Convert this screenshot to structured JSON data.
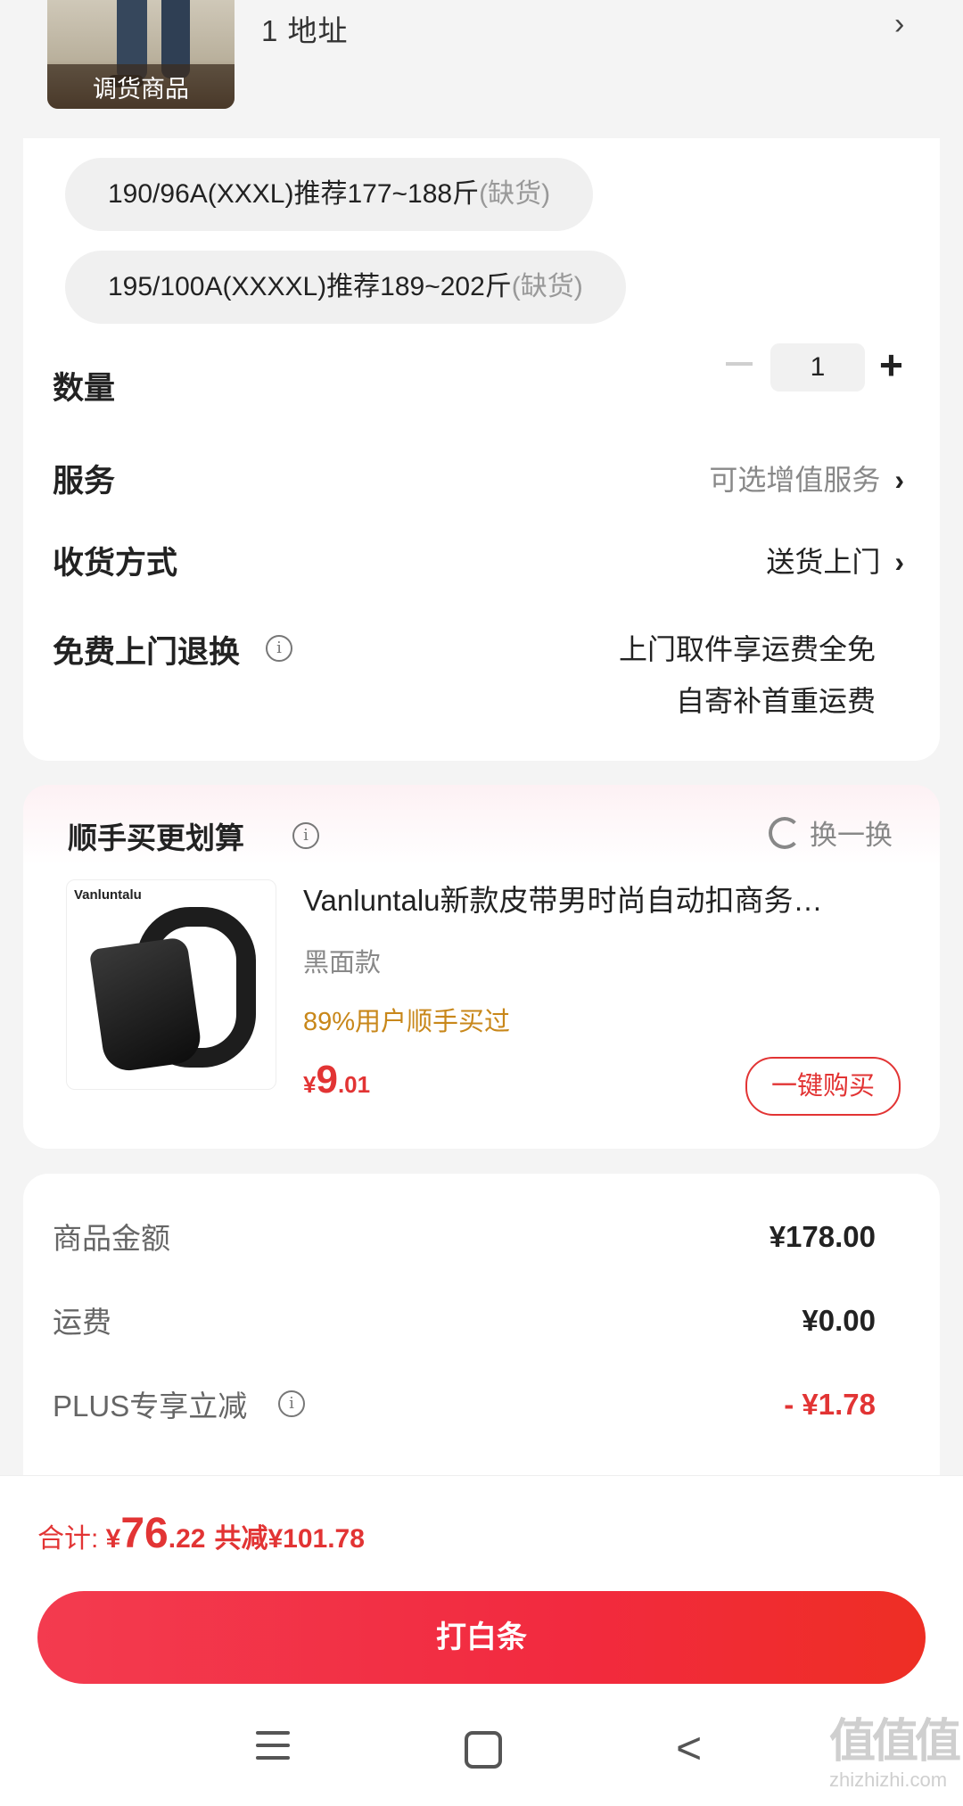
{
  "product": {
    "thumb_label": "调货商品",
    "address_line": "1  地址",
    "address_arrow": "›"
  },
  "options": {
    "sizes": [
      {
        "label": "190/96A(XXXL)推荐177~188斤",
        "status": "(缺货)"
      },
      {
        "label": "195/100A(XXXXL)推荐189~202斤",
        "status": "(缺货)"
      }
    ],
    "quantity": {
      "label": "数量",
      "minus": "−",
      "value": "1",
      "plus": "+"
    },
    "service": {
      "label": "服务",
      "value": "可选增值服务",
      "arrow": "›"
    },
    "delivery": {
      "label": "收货方式",
      "value": "送货上门",
      "arrow": "›"
    },
    "return": {
      "label": "免费上门退换",
      "info": "i",
      "line1": "上门取件享运费全免",
      "line2": "自寄补首重运费"
    }
  },
  "recommend": {
    "title": "顺手买更划算",
    "info": "i",
    "refresh_label": "换一换",
    "image_brand": "Vanluntalu",
    "name": "Vanluntalu新款皮带男时尚自动扣商务…",
    "variant": "黑面款",
    "social": "89%用户顺手买过",
    "price": {
      "symbol": "¥",
      "int": "9",
      "dec": ".01"
    },
    "buy_label": "一键购买"
  },
  "summary": {
    "items": [
      {
        "label": "商品金额",
        "value": "¥178.00"
      },
      {
        "label": "运费",
        "value": "¥0.00"
      },
      {
        "label": "PLUS专享立减",
        "value": "- ¥1.78",
        "info": "i"
      }
    ]
  },
  "footer": {
    "total_label": "合计: ",
    "total_symbol": "¥",
    "total_int": "76",
    "total_dec": ".22",
    "saved": "共减¥101.78",
    "pay_label": "打白条"
  },
  "nav": {
    "back": "<"
  },
  "watermark": {
    "main": "值值值",
    "sub": "zhizhizhi.com"
  },
  "colors": {
    "accent": "#e23434",
    "social": "#c8871a",
    "pay_start": "#f33b4f",
    "pay_end": "#ee2e24"
  },
  "icons": [
    "chevron-right-icon",
    "minus-icon",
    "plus-icon",
    "info-icon",
    "refresh-icon",
    "menu-icon",
    "home-icon",
    "back-icon"
  ]
}
